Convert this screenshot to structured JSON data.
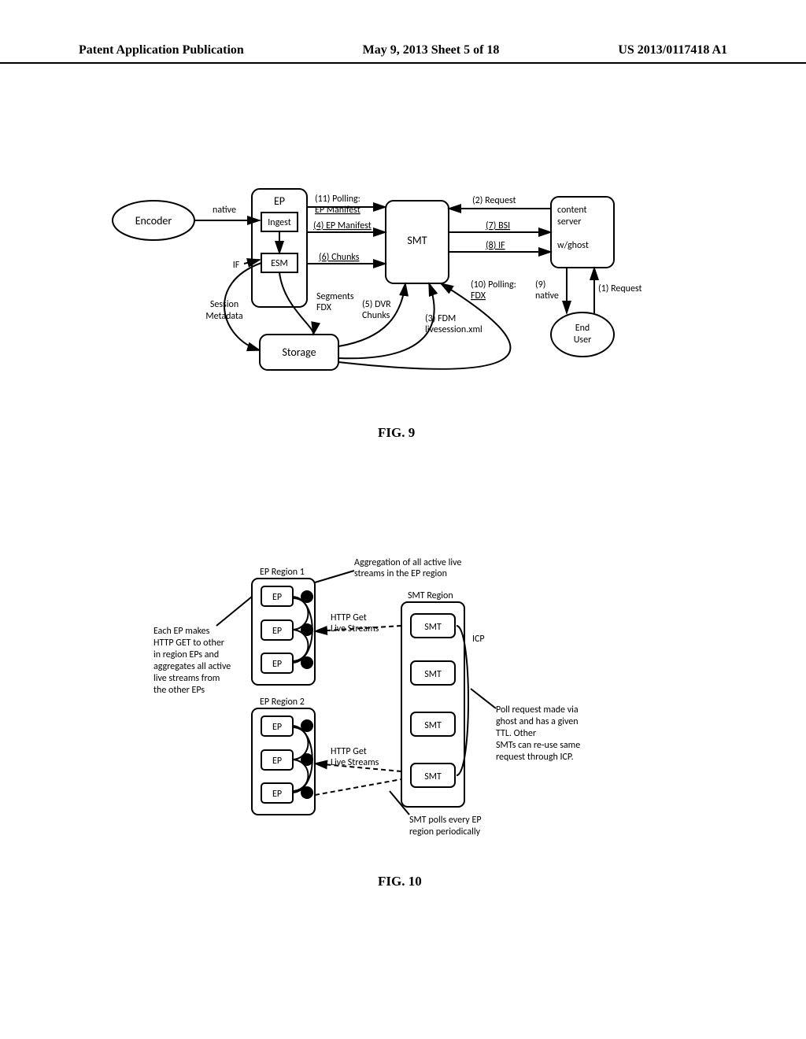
{
  "header": {
    "left": "Patent Application Publication",
    "center": "May 9, 2013  Sheet 5 of 18",
    "right": "US 2013/0117418 A1"
  },
  "fig9": {
    "caption": "FIG. 9",
    "encoder": "Encoder",
    "native": "native",
    "ep": "EP",
    "ingest": "Ingest",
    "esm": "ESM",
    "if": "IF",
    "session": "Session",
    "metadata": "Metadata",
    "storage": "Storage",
    "smt": "SMT",
    "seg": "Segments",
    "fdx1": "FDX",
    "chunks_l": "Chunks",
    "dvr5": "(5) DVR",
    "fdm3": "(3) FDM",
    "live": "livesession.xml",
    "e11": "(11) Polling:",
    "e11b": "EP Manifest",
    "e4": "(4) EP Manifest",
    "e6": "(6) Chunks",
    "e2": "(2) Request",
    "e7": "(7) BSI",
    "e8": "(8) IF",
    "e10": "(10) Polling:",
    "e10b": "FDX",
    "e9": "(9)",
    "e9b": "native",
    "e1": "(1) Request",
    "content": "content",
    "server": "server",
    "wghost": "w/ghost",
    "end": "End",
    "user": "User"
  },
  "fig10": {
    "caption": "FIG. 10",
    "r1": "EP Region 1",
    "r2": "EP Region 2",
    "ep": "EP",
    "smtRegion": "SMT Region",
    "smt": "SMT",
    "httpget": "HTTP Get",
    "lstreams": "Live Streams",
    "icp": "ICP",
    "agg": "Aggregation of all active live",
    "agg2": "streams in the EP region",
    "left1": "Each EP makes",
    "left2": "HTTP GET to other",
    "left3": "in region EPs and",
    "left4": "aggregates all active",
    "left5": "live streams from",
    "left6": "the other EPs",
    "right1": "Poll request made via",
    "right2": "ghost and has a given",
    "right3": "TTL.  Other",
    "right4": "SMTs can re-use same",
    "right5": "request through ICP.",
    "poll1": "SMT polls every EP",
    "poll2": "region periodically"
  }
}
